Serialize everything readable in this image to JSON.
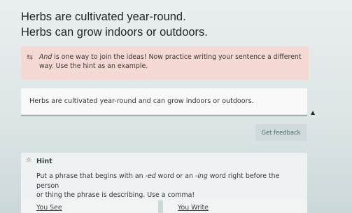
{
  "sentences": [
    "Herbs are cultivated year-round.",
    "Herbs can grow indoors or outdoors."
  ],
  "feedback": {
    "icon": "swap-icon",
    "emph_word": "And",
    "line1_rest": " is one way to join the ideas! Now practice writing your sentence a different",
    "line2": "way. Use the hint as an example."
  },
  "answer": {
    "text": "Herbs are cultivated year-round and can grow indoors or outdoors."
  },
  "get_feedback_label": "Get feedback",
  "hint": {
    "icon": "lightbulb-icon",
    "title": "Hint",
    "seg1": "Put a phrase that begins with an -",
    "emph1": "ed",
    "seg2": " word or an -",
    "emph2": "ing",
    "seg3": " word right before the person",
    "line2": "or thing the phrase is describing. Use a comma!"
  },
  "tabs": {
    "you_see": "You See",
    "you_write": "You Write"
  }
}
